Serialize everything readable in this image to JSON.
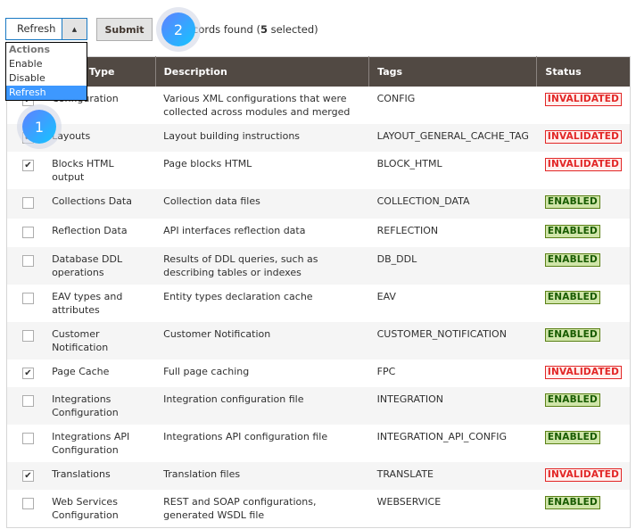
{
  "toolbar": {
    "selected_action": "Refresh",
    "submit_label": "Submit",
    "records_text_prefix": "cords found (",
    "selected_count": "5",
    "records_text_suffix": " selected)"
  },
  "dropdown": {
    "group": "Actions",
    "options": [
      "Enable",
      "Disable",
      "Refresh"
    ],
    "highlighted": "Refresh"
  },
  "badges": [
    "1",
    "2"
  ],
  "table": {
    "headers": [
      "",
      "Cache Type",
      "Description",
      "Tags",
      "Status"
    ],
    "rows": [
      {
        "type": "Configuration",
        "desc": "Various XML configurations that were collected across modules and merged",
        "tags": "CONFIG",
        "status": "INVALIDATED",
        "checked": true
      },
      {
        "type": "Layouts",
        "desc": "Layout building instructions",
        "tags": "LAYOUT_GENERAL_CACHE_TAG",
        "status": "INVALIDATED",
        "checked": true
      },
      {
        "type": "Blocks HTML output",
        "desc": "Page blocks HTML",
        "tags": "BLOCK_HTML",
        "status": "INVALIDATED",
        "checked": true
      },
      {
        "type": "Collections Data",
        "desc": "Collection data files",
        "tags": "COLLECTION_DATA",
        "status": "ENABLED",
        "checked": false
      },
      {
        "type": "Reflection Data",
        "desc": "API interfaces reflection data",
        "tags": "REFLECTION",
        "status": "ENABLED",
        "checked": false
      },
      {
        "type": "Database DDL operations",
        "desc": "Results of DDL queries, such as describing tables or indexes",
        "tags": "DB_DDL",
        "status": "ENABLED",
        "checked": false
      },
      {
        "type": "EAV types and attributes",
        "desc": "Entity types declaration cache",
        "tags": "EAV",
        "status": "ENABLED",
        "checked": false
      },
      {
        "type": "Customer Notification",
        "desc": "Customer Notification",
        "tags": "CUSTOMER_NOTIFICATION",
        "status": "ENABLED",
        "checked": false
      },
      {
        "type": "Page Cache",
        "desc": "Full page caching",
        "tags": "FPC",
        "status": "INVALIDATED",
        "checked": true
      },
      {
        "type": "Integrations Configuration",
        "desc": "Integration configuration file",
        "tags": "INTEGRATION",
        "status": "ENABLED",
        "checked": false
      },
      {
        "type": "Integrations API Configuration",
        "desc": "Integrations API configuration file",
        "tags": "INTEGRATION_API_CONFIG",
        "status": "ENABLED",
        "checked": false
      },
      {
        "type": "Translations",
        "desc": "Translation files",
        "tags": "TRANSLATE",
        "status": "INVALIDATED",
        "checked": true
      },
      {
        "type": "Web Services Configuration",
        "desc": "REST and SOAP configurations, generated WSDL file",
        "tags": "WEBSERVICE",
        "status": "ENABLED",
        "checked": false
      }
    ]
  },
  "colors": {
    "header_bg": "#514943",
    "invalid": "#e22626",
    "enabled_bg": "#d0e5a9",
    "highlight": "#3d98ff"
  }
}
